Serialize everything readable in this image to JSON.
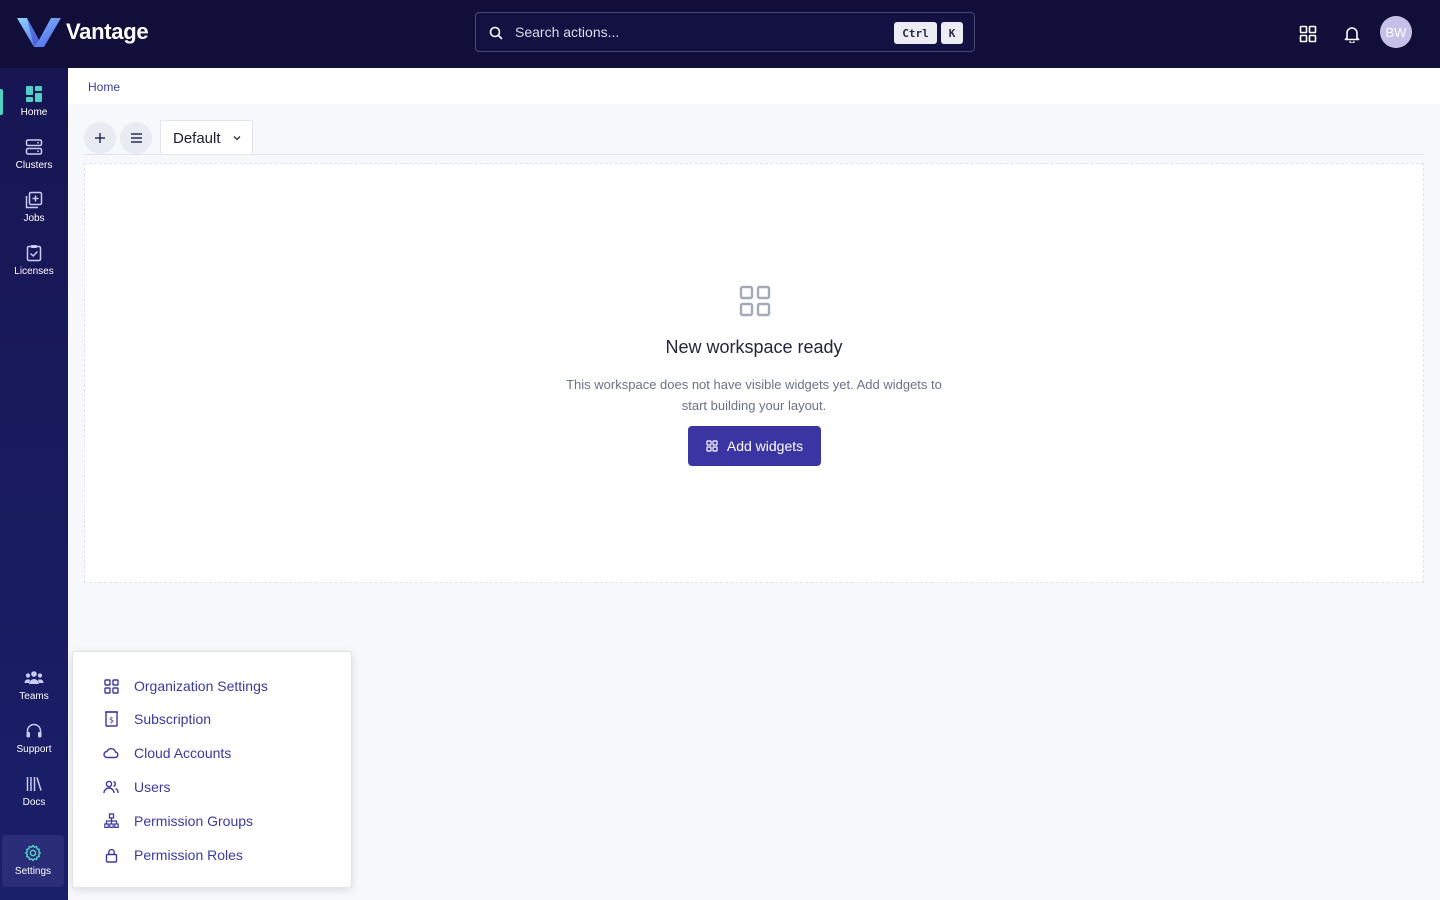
{
  "app": {
    "name": "Vantage"
  },
  "search": {
    "placeholder": "Search actions...",
    "shortcut_modifier": "Ctrl",
    "shortcut_key": "K"
  },
  "header": {
    "avatar_initials": "BW"
  },
  "sidebar": {
    "items": [
      {
        "label": "Home",
        "icon": "dashboard-icon",
        "active": true
      },
      {
        "label": "Clusters",
        "icon": "server-icon"
      },
      {
        "label": "Jobs",
        "icon": "add-square-icon"
      },
      {
        "label": "Licenses",
        "icon": "clipboard-check-icon"
      }
    ],
    "bottom_items": [
      {
        "label": "Teams",
        "icon": "teams-icon"
      },
      {
        "label": "Support",
        "icon": "headset-icon"
      },
      {
        "label": "Docs",
        "icon": "library-icon"
      },
      {
        "label": "Settings",
        "icon": "gear-icon",
        "highlighted": true
      }
    ]
  },
  "breadcrumb": {
    "home": "Home"
  },
  "workspace": {
    "tab_label": "Default"
  },
  "empty_state": {
    "title": "New workspace ready",
    "description": "This workspace does not have visible widgets yet. Add widgets to start building your layout.",
    "button_label": "Add widgets"
  },
  "settings_menu": {
    "items": [
      {
        "label": "Organization Settings",
        "icon": "grid-icon"
      },
      {
        "label": "Subscription",
        "icon": "invoice-icon"
      },
      {
        "label": "Cloud Accounts",
        "icon": "cloud-icon"
      },
      {
        "label": "Users",
        "icon": "users-icon"
      },
      {
        "label": "Permission Groups",
        "icon": "hierarchy-icon"
      },
      {
        "label": "Permission Roles",
        "icon": "lock-icon"
      }
    ]
  },
  "colors": {
    "topbar": "#110f3a",
    "sidebar": "#191a5c",
    "accent": "#3b34a3",
    "active_indicator": "#4fd1c5",
    "link": "#3b3aa0"
  }
}
